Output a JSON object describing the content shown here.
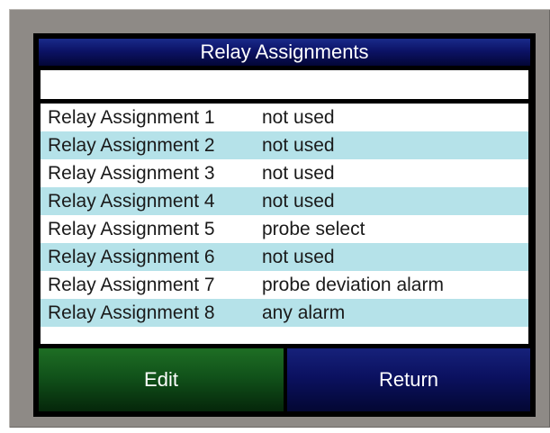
{
  "screen": {
    "title": "Relay Assignments",
    "edit_value": ""
  },
  "relays": [
    {
      "label": "Relay Assignment 1",
      "value": "not used"
    },
    {
      "label": "Relay Assignment 2",
      "value": "not used"
    },
    {
      "label": "Relay Assignment 3",
      "value": "not used"
    },
    {
      "label": "Relay Assignment 4",
      "value": "not used"
    },
    {
      "label": "Relay Assignment 5",
      "value": "probe select"
    },
    {
      "label": "Relay Assignment 6",
      "value": "not used"
    },
    {
      "label": "Relay Assignment 7",
      "value": "probe deviation alarm"
    },
    {
      "label": "Relay Assignment 8",
      "value": "any alarm"
    }
  ],
  "buttons": {
    "edit_label": "Edit",
    "return_label": "Return"
  },
  "colors": {
    "title_bar": "#0c1366",
    "row_alt": "#b5e2e9",
    "edit_button": "#11521a",
    "return_button": "#0b1160",
    "bezel": "#8e8a86"
  }
}
